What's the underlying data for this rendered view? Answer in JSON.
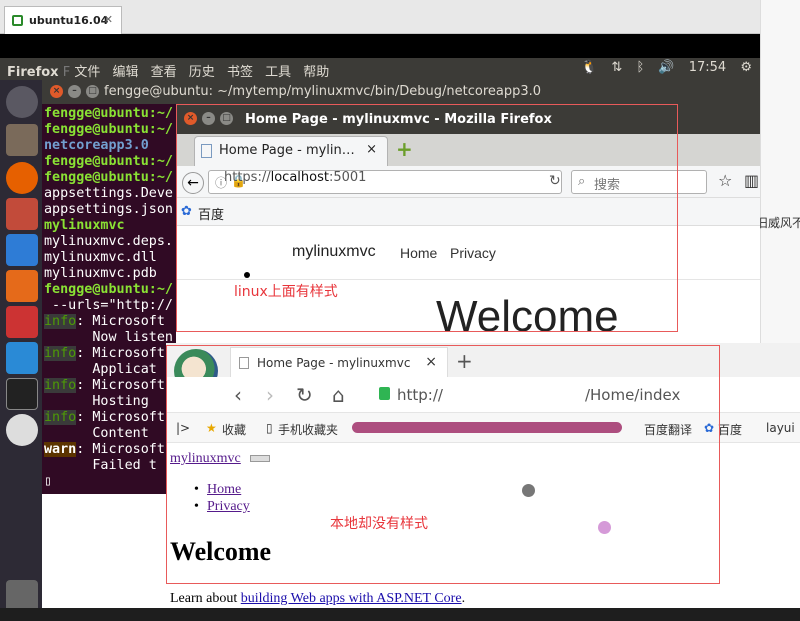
{
  "host": {
    "tab_title": "ubuntu16.04",
    "close": "✕",
    "side_text": "旧威风不"
  },
  "panel": {
    "app": "Firefox",
    "menus": [
      "文件",
      "编辑",
      "查看",
      "历史",
      "书签",
      "工具",
      "帮助"
    ],
    "time": "17:54"
  },
  "terminal": {
    "title": "fengge@ubuntu: ~/mytemp/mylinuxmvc/bin/Debug/netcoreapp3.0",
    "lines": [
      {
        "t": "fengge@ubuntu:~/",
        "c": "g"
      },
      {
        "t": "fengge@ubuntu:~/",
        "c": "g"
      },
      {
        "t": "netcoreapp3.0",
        "c": "b"
      },
      {
        "t": "fengge@ubuntu:~/",
        "c": "g"
      },
      {
        "t": "fengge@ubuntu:~/",
        "c": "g"
      },
      {
        "t": "appsettings.Deve",
        "c": ""
      },
      {
        "t": "appsettings.json",
        "c": ""
      },
      {
        "t": "mylinuxmvc",
        "c": "g"
      },
      {
        "t": "mylinuxmvc.deps.",
        "c": ""
      },
      {
        "t": "mylinuxmvc.dll",
        "c": ""
      },
      {
        "t": "mylinuxmvc.pdb",
        "c": ""
      },
      {
        "t": "fengge@ubuntu:~/",
        "c": "g"
      },
      {
        "t": " --urls=\"http://",
        "c": ""
      },
      {
        "t": "info: Microsoft",
        "c": "i"
      },
      {
        "t": "      Now listen",
        "c": ""
      },
      {
        "t": "info: Microsoft",
        "c": "i"
      },
      {
        "t": "      Applicat",
        "c": ""
      },
      {
        "t": "info: Microsoft",
        "c": "i"
      },
      {
        "t": "      Hosting",
        "c": ""
      },
      {
        "t": "info: Microsoft",
        "c": "i"
      },
      {
        "t": "      Content",
        "c": ""
      },
      {
        "t": "warn: Microsoft",
        "c": "w"
      },
      {
        "t": "      Failed t",
        "c": ""
      },
      {
        "t": "▯",
        "c": ""
      }
    ]
  },
  "firefox": {
    "window_title": "Home Page - mylinuxmvc - Mozilla Firefox",
    "tab_label": "Home Page - mylin…",
    "tab_close": "×",
    "new_tab": "+",
    "url_scheme": "https://",
    "url_host": "localhost",
    "url_port": ":5001",
    "search_placeholder": "搜索",
    "bookmark": "百度",
    "brand": "mylinuxmvc",
    "nav": [
      "Home",
      "Privacy"
    ],
    "heading": "Welcome"
  },
  "annotations": {
    "linux_note": "linux上面有样式",
    "local_note": "本地却没有样式"
  },
  "local_browser": {
    "tab_label": "Home Page - mylinuxmvc",
    "tab_close": "×",
    "new_tab": "+",
    "address_scheme": "http://",
    "address_path": "/Home/index",
    "bookmarks": [
      "收藏",
      "手机收藏夹",
      "百度翻译",
      "百度",
      "layui"
    ],
    "brand_link": "mylinuxmvc",
    "nav": [
      "Home",
      "Privacy"
    ],
    "heading": "Welcome",
    "learn_prefix": "Learn about ",
    "learn_link": "building Web apps with ASP.NET Core",
    "learn_suffix": "."
  },
  "colors": {
    "terminal_bg": "#300a24",
    "prompt_green": "#8ae234",
    "dir_blue": "#729fcf",
    "annotation_red": "#e8353b",
    "ubuntu_panel": "#3c3b37"
  }
}
